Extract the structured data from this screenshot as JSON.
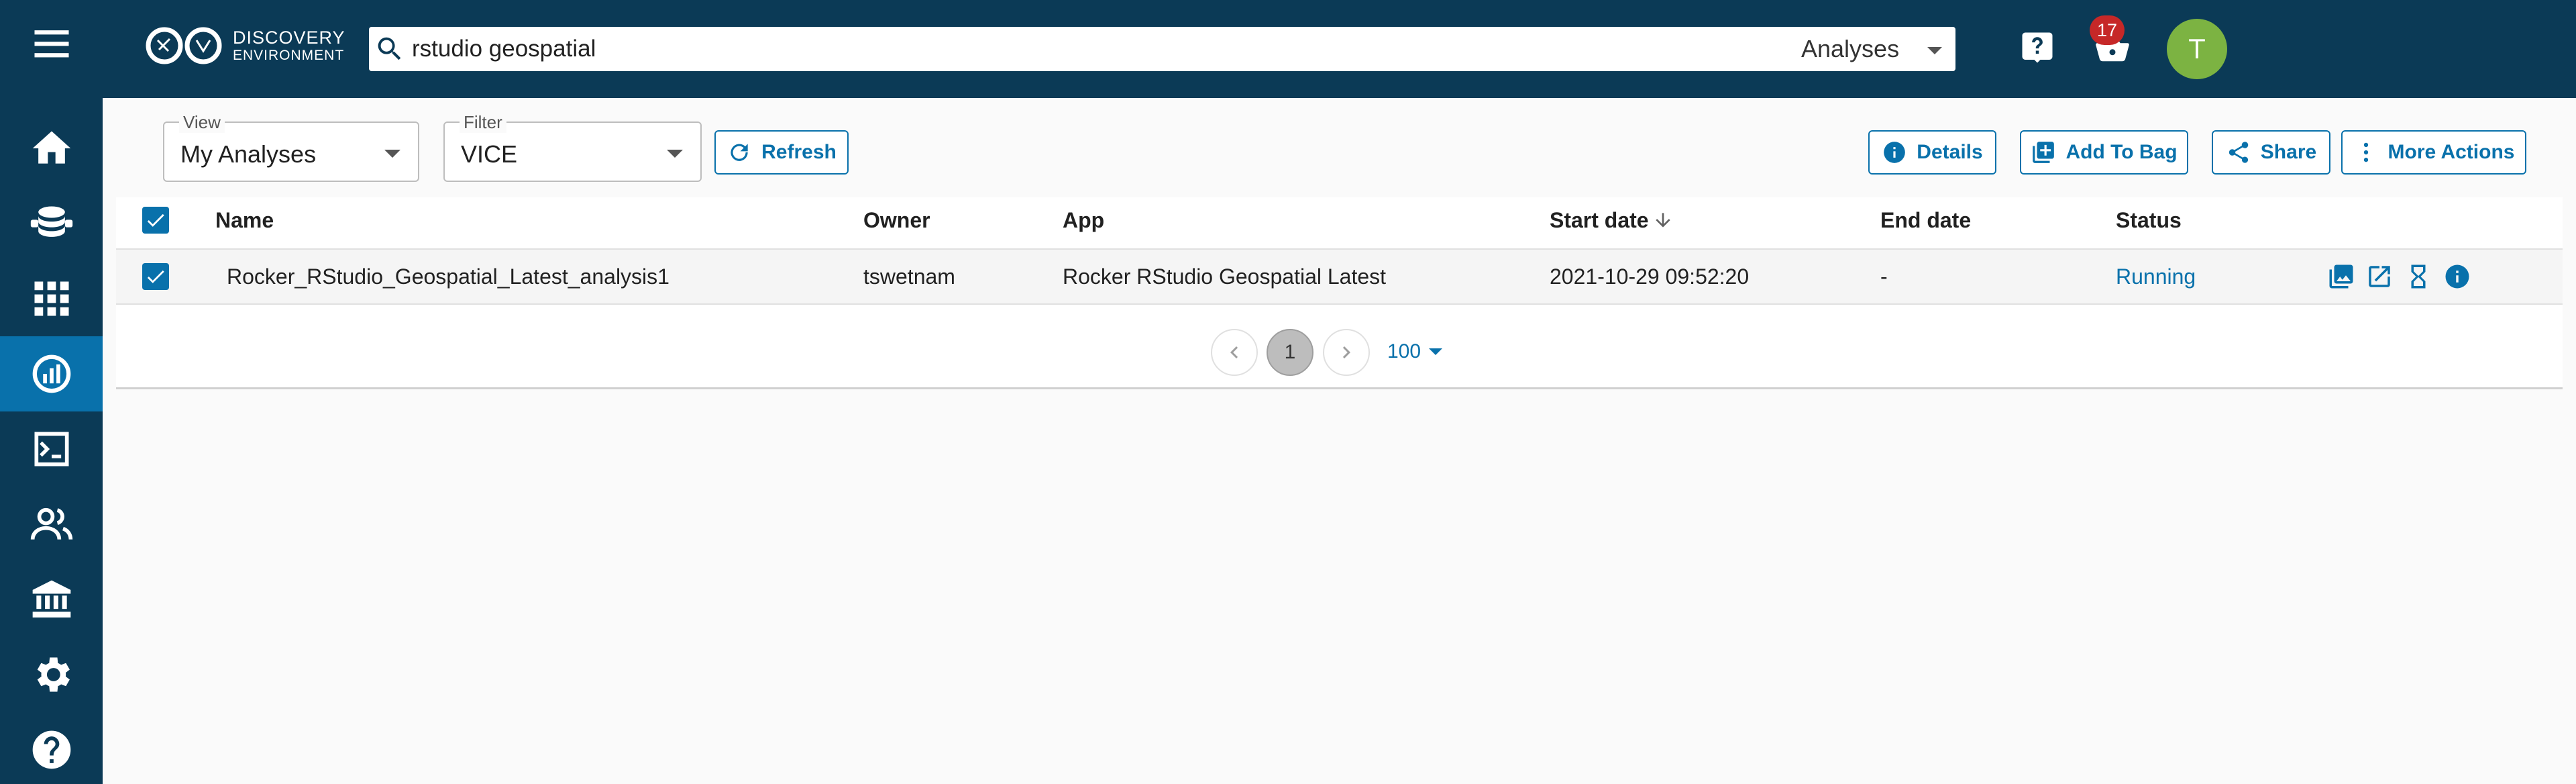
{
  "app": {
    "logo_line1": "DISCOVERY",
    "logo_line2": "ENVIRONMENT"
  },
  "sidebar": {
    "items": [
      {
        "icon": "home-icon"
      },
      {
        "icon": "data-icon"
      },
      {
        "icon": "apps-icon"
      },
      {
        "icon": "analyses-icon",
        "active": true
      },
      {
        "icon": "terminal-icon"
      },
      {
        "icon": "teams-icon"
      },
      {
        "icon": "institution-icon"
      },
      {
        "icon": "settings-icon"
      },
      {
        "icon": "help-icon"
      }
    ]
  },
  "header": {
    "search_value": "rstudio geospatial",
    "search_type": "Analyses",
    "notification_count": "17",
    "avatar_initial": "T"
  },
  "toolbar": {
    "view_label": "View",
    "view_value": "My Analyses",
    "filter_label": "Filter",
    "filter_value": "VICE",
    "refresh_label": "Refresh",
    "details_label": "Details",
    "add_to_bag_label": "Add To Bag",
    "share_label": "Share",
    "more_actions_label": "More Actions"
  },
  "table": {
    "columns": {
      "name": "Name",
      "owner": "Owner",
      "app": "App",
      "start_date": "Start date",
      "end_date": "End date",
      "status": "Status"
    },
    "rows": [
      {
        "name": "Rocker_RStudio_Geospatial_Latest_analysis1",
        "owner": "tswetnam",
        "app": "Rocker RStudio Geospatial Latest",
        "start_date": "2021-10-29 09:52:20",
        "end_date": "-",
        "status": "Running",
        "selected": true
      }
    ]
  },
  "pagination": {
    "current_page": "1",
    "page_size": "100"
  },
  "colors": {
    "nav_bg": "#0b3a56",
    "accent": "#0971ab",
    "avatar": "#7cb342",
    "badge": "#c62828"
  }
}
